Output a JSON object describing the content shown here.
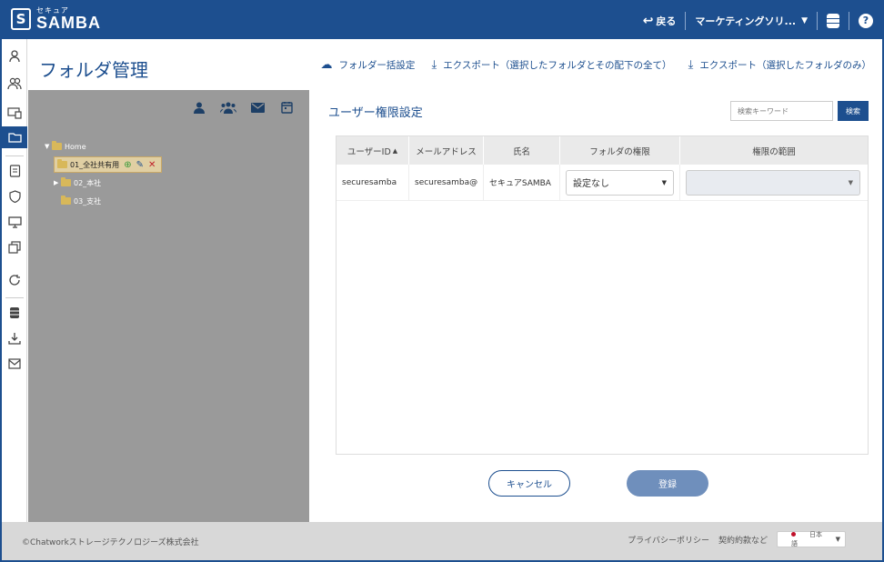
{
  "header": {
    "logo_sub": "セキュア",
    "logo_main": "SAMBA",
    "back_label": "戻る",
    "account_label": "マーケティングソリ..."
  },
  "page": {
    "title": "フォルダ管理",
    "actions": [
      {
        "label": "フォルダー括設定",
        "icon": "cloud-upload-icon"
      },
      {
        "label": "エクスポート（選択したフォルダとその配下の全て）",
        "icon": "download-icon"
      },
      {
        "label": "エクスポート（選択したフォルダのみ）",
        "icon": "download-icon"
      }
    ]
  },
  "tree": {
    "root": "Home",
    "items": [
      "01_全社共有用",
      "02_本社",
      "03_支社"
    ]
  },
  "panel": {
    "title": "ユーザー権限設定",
    "search_placeholder": "検索キーワード",
    "search_label": "検索",
    "columns": [
      "ユーザーID",
      "メールアドレス",
      "氏名",
      "フォルダの権限",
      "権限の範囲"
    ],
    "row": {
      "user_id": "securesamba",
      "email": "securesamba@",
      "name": "セキュアSAMBA",
      "permission": "設定なし",
      "scope": ""
    },
    "cancel_label": "キャンセル",
    "submit_label": "登録"
  },
  "footer": {
    "copyright": "©Chatworkストレージテクノロジーズ株式会社",
    "privacy": "プライバシーポリシー",
    "terms": "契約約款など",
    "language": "日本語"
  },
  "colors": {
    "brand": "#1d4f8f",
    "tree_bg": "#9a9a9a"
  }
}
